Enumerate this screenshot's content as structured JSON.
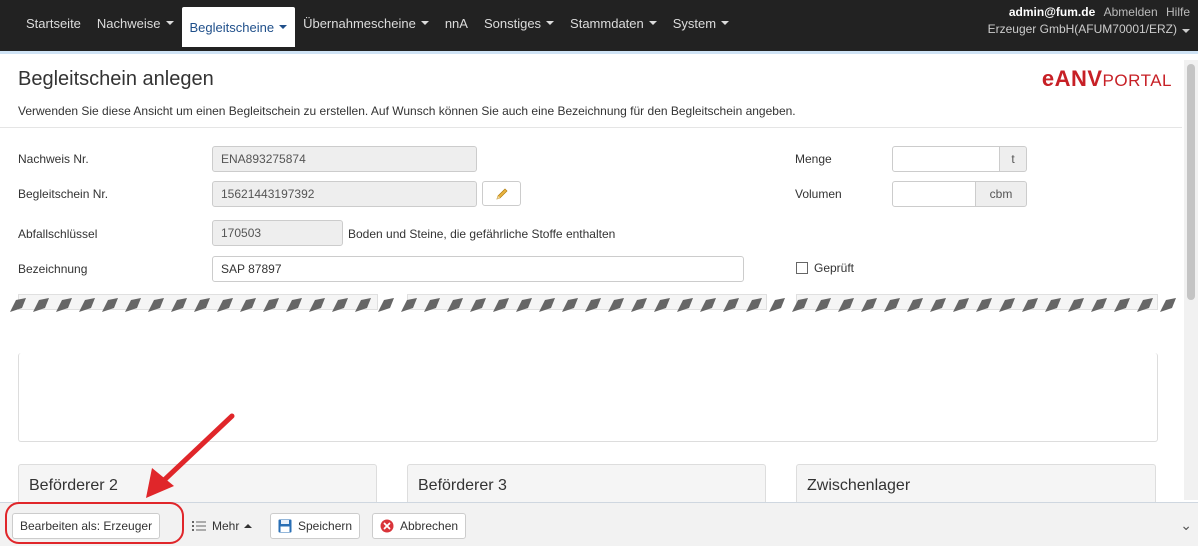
{
  "nav": {
    "items": [
      {
        "label": "Startseite",
        "caret": false,
        "active": false
      },
      {
        "label": "Nachweise",
        "caret": true,
        "active": false
      },
      {
        "label": "Begleitscheine",
        "caret": true,
        "active": true
      },
      {
        "label": "Übernahmescheine",
        "caret": true,
        "active": false
      },
      {
        "label": "nnA",
        "caret": false,
        "active": false
      },
      {
        "label": "Sonstiges",
        "caret": true,
        "active": false
      },
      {
        "label": "Stammdaten",
        "caret": true,
        "active": false
      },
      {
        "label": "System",
        "caret": true,
        "active": false
      }
    ],
    "user": "admin@fum.de",
    "logout": "Abmelden",
    "help": "Hilfe",
    "company": "Erzeuger GmbH(AFUM70001/ERZ)"
  },
  "page": {
    "title": "Begleitschein anlegen",
    "logo_main": "eANV",
    "logo_sub": "PORTAL",
    "intro": "Verwenden Sie diese Ansicht um einen Begleitschein zu erstellen. Auf Wunsch können Sie auch eine Bezeichnung für den Begleitschein angeben."
  },
  "form": {
    "nachweis_label": "Nachweis Nr.",
    "nachweis_value": "ENA893275874",
    "begleitschein_label": "Begleitschein Nr.",
    "begleitschein_value": "15621443197392",
    "abfall_label": "Abfallschlüssel",
    "abfall_value": "170503",
    "abfall_desc": "Boden und Steine, die gefährliche Stoffe enthalten",
    "bezeichnung_label": "Bezeichnung",
    "bezeichnung_value": "SAP 87897",
    "menge_label": "Menge",
    "menge_value": "",
    "menge_unit": "t",
    "volumen_label": "Volumen",
    "volumen_value": "",
    "volumen_unit": "cbm",
    "geprueft_label": "Geprüft",
    "geprueft_checked": false
  },
  "panels": {
    "beforderer2": "Beförderer 2",
    "beforderer3": "Beförderer 3",
    "zwischenlager": "Zwischenlager"
  },
  "toolbar": {
    "bearbeiten": "Bearbeiten als: Erzeuger",
    "mehr": "Mehr",
    "speichern": "Speichern",
    "abbrechen": "Abbrechen"
  },
  "colors": {
    "accent": "#1f4f8a",
    "logo": "#c72026",
    "highlight": "#e0262a",
    "cancel_icon": "#d9343a",
    "save_icon": "#2a6fb5"
  }
}
